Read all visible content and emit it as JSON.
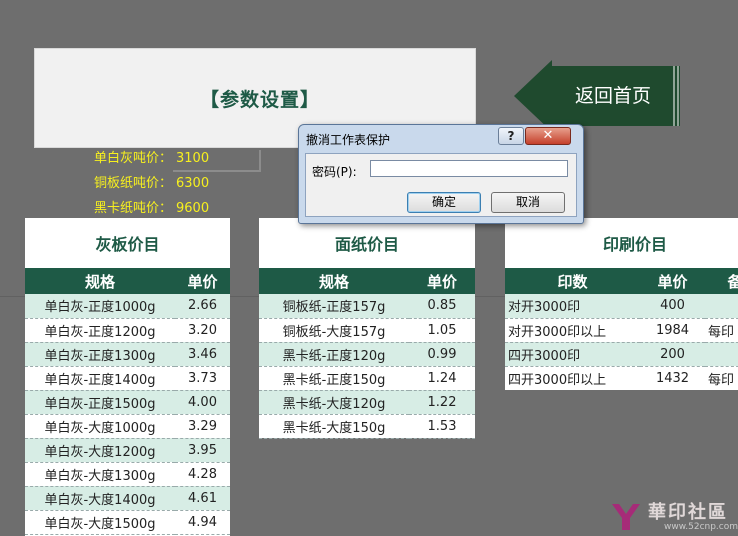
{
  "header": {
    "title": "【参数设置】"
  },
  "back_button": {
    "label": "返回首页"
  },
  "params": [
    {
      "label": "单白灰吨价：",
      "value": "3100"
    },
    {
      "label": "铜板纸吨价：",
      "value": "6300"
    },
    {
      "label": "黑卡纸吨价：",
      "value": "9600"
    }
  ],
  "gray_board": {
    "title": "灰板价目",
    "columns": [
      "规格",
      "单价"
    ],
    "rows": [
      [
        "单白灰-正度1000g",
        "2.66"
      ],
      [
        "单白灰-正度1200g",
        "3.20"
      ],
      [
        "单白灰-正度1300g",
        "3.46"
      ],
      [
        "单白灰-正度1400g",
        "3.73"
      ],
      [
        "单白灰-正度1500g",
        "4.00"
      ],
      [
        "单白灰-大度1000g",
        "3.29"
      ],
      [
        "单白灰-大度1200g",
        "3.95"
      ],
      [
        "单白灰-大度1300g",
        "4.28"
      ],
      [
        "单白灰-大度1400g",
        "4.61"
      ],
      [
        "单白灰-大度1500g",
        "4.94"
      ]
    ]
  },
  "paper": {
    "title": "面纸价目",
    "columns": [
      "规格",
      "单价"
    ],
    "rows": [
      [
        "铜板纸-正度157g",
        "0.85"
      ],
      [
        "铜板纸-大度157g",
        "1.05"
      ],
      [
        "黑卡纸-正度120g",
        "0.99"
      ],
      [
        "黑卡纸-正度150g",
        "1.24"
      ],
      [
        "黑卡纸-大度120g",
        "1.22"
      ],
      [
        "黑卡纸-大度150g",
        "1.53"
      ]
    ]
  },
  "printing": {
    "title": "印刷价目",
    "columns": [
      "印数",
      "单价",
      "备"
    ],
    "rows": [
      [
        "对开3000印",
        "400",
        ""
      ],
      [
        "对开3000印以上",
        "1984",
        "每印"
      ],
      [
        "四开3000印",
        "200",
        ""
      ],
      [
        "四开3000印以上",
        "1432",
        "每印"
      ]
    ]
  },
  "dialog": {
    "title": "撤消工作表保护",
    "help": "?",
    "close": "✕",
    "password_label": "密码(P):",
    "password_value": "",
    "ok": "确定",
    "cancel": "取消"
  },
  "watermark": {
    "name": "華印社區",
    "url": "www.52cnp.com"
  },
  "colors": {
    "header_green": "#1e5a46",
    "band": "#d7ede5",
    "param_yellow": "#f7f01e",
    "back_button": "#1f4a2e"
  }
}
